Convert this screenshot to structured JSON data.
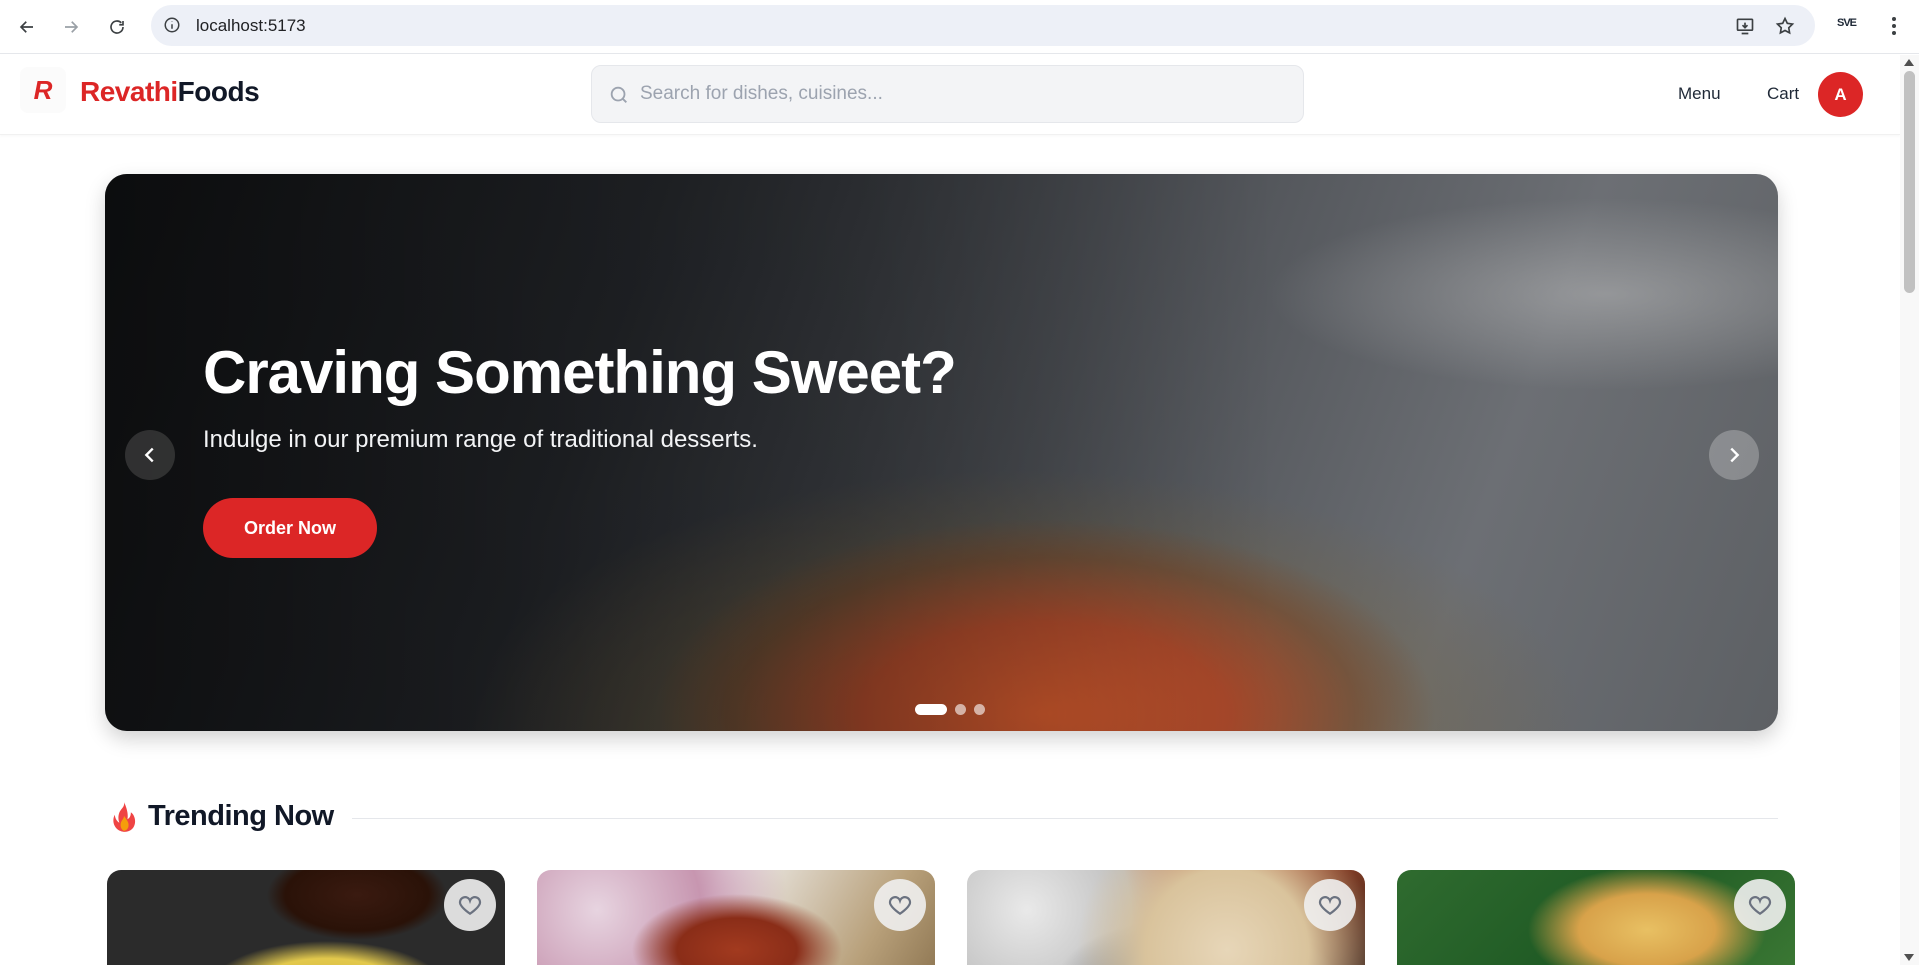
{
  "browser": {
    "url": "localhost:5173",
    "extension_label": "SVE"
  },
  "header": {
    "brand_part1": "Revathi",
    "brand_part2": "Foods",
    "logo_letter": "R",
    "search_placeholder": "Search for dishes, cuisines...",
    "nav": [
      "Menu",
      "Cart"
    ],
    "avatar_initial": "A"
  },
  "hero": {
    "title": "Craving Something Sweet?",
    "subtitle": "Indulge in our premium range of traditional desserts.",
    "cta": "Order Now",
    "slide_count": 3,
    "active_slide": 1
  },
  "section": {
    "title": "Trending Now",
    "cards": [
      {
        "favorite": false
      },
      {
        "favorite": false
      },
      {
        "favorite": false
      },
      {
        "favorite": false
      }
    ]
  },
  "colors": {
    "brand_red": "#dc2626",
    "text_dark": "#111827"
  }
}
